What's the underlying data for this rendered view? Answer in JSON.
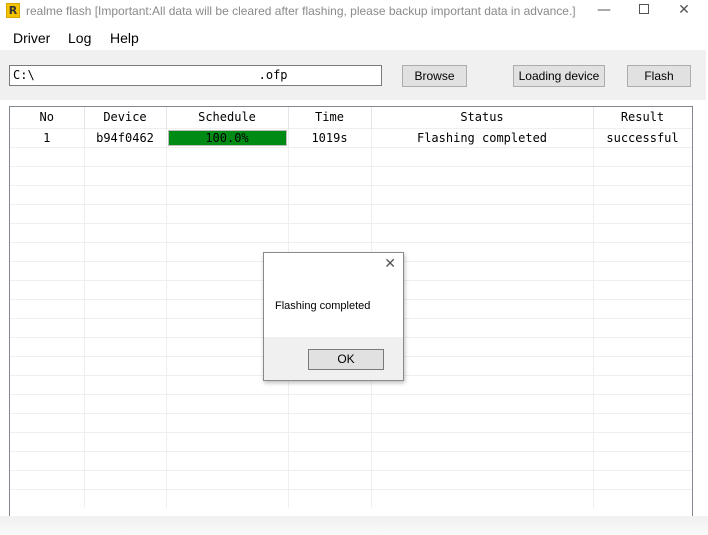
{
  "window": {
    "title": "realme flash [Important:All data will be cleared after flashing, please backup important data in advance.]",
    "app_icon_glyph": "R",
    "minimize_glyph": "—",
    "close_glyph": "✕"
  },
  "menu": {
    "items": [
      {
        "label": "Driver"
      },
      {
        "label": "Log"
      },
      {
        "label": "Help"
      }
    ]
  },
  "toolbar": {
    "path_value": "C:\\                               .ofp",
    "browse_label": "Browse",
    "loading_device_label": "Loading device",
    "flash_label": "Flash"
  },
  "table": {
    "headers": [
      "No",
      "Device",
      "Schedule",
      "Time",
      "Status",
      "Result"
    ],
    "rows": [
      {
        "no": "1",
        "device": "b94f0462",
        "schedule_label": "100.0%",
        "schedule_progress": 1.0,
        "time": "1019s",
        "status": "Flashing completed",
        "result": "successful"
      }
    ]
  },
  "dialog": {
    "message": "Flashing completed",
    "ok_label": "OK",
    "close_glyph": "✕"
  },
  "colors": {
    "progress_fill": "#008c14",
    "title_text": "#8a8a8a"
  }
}
